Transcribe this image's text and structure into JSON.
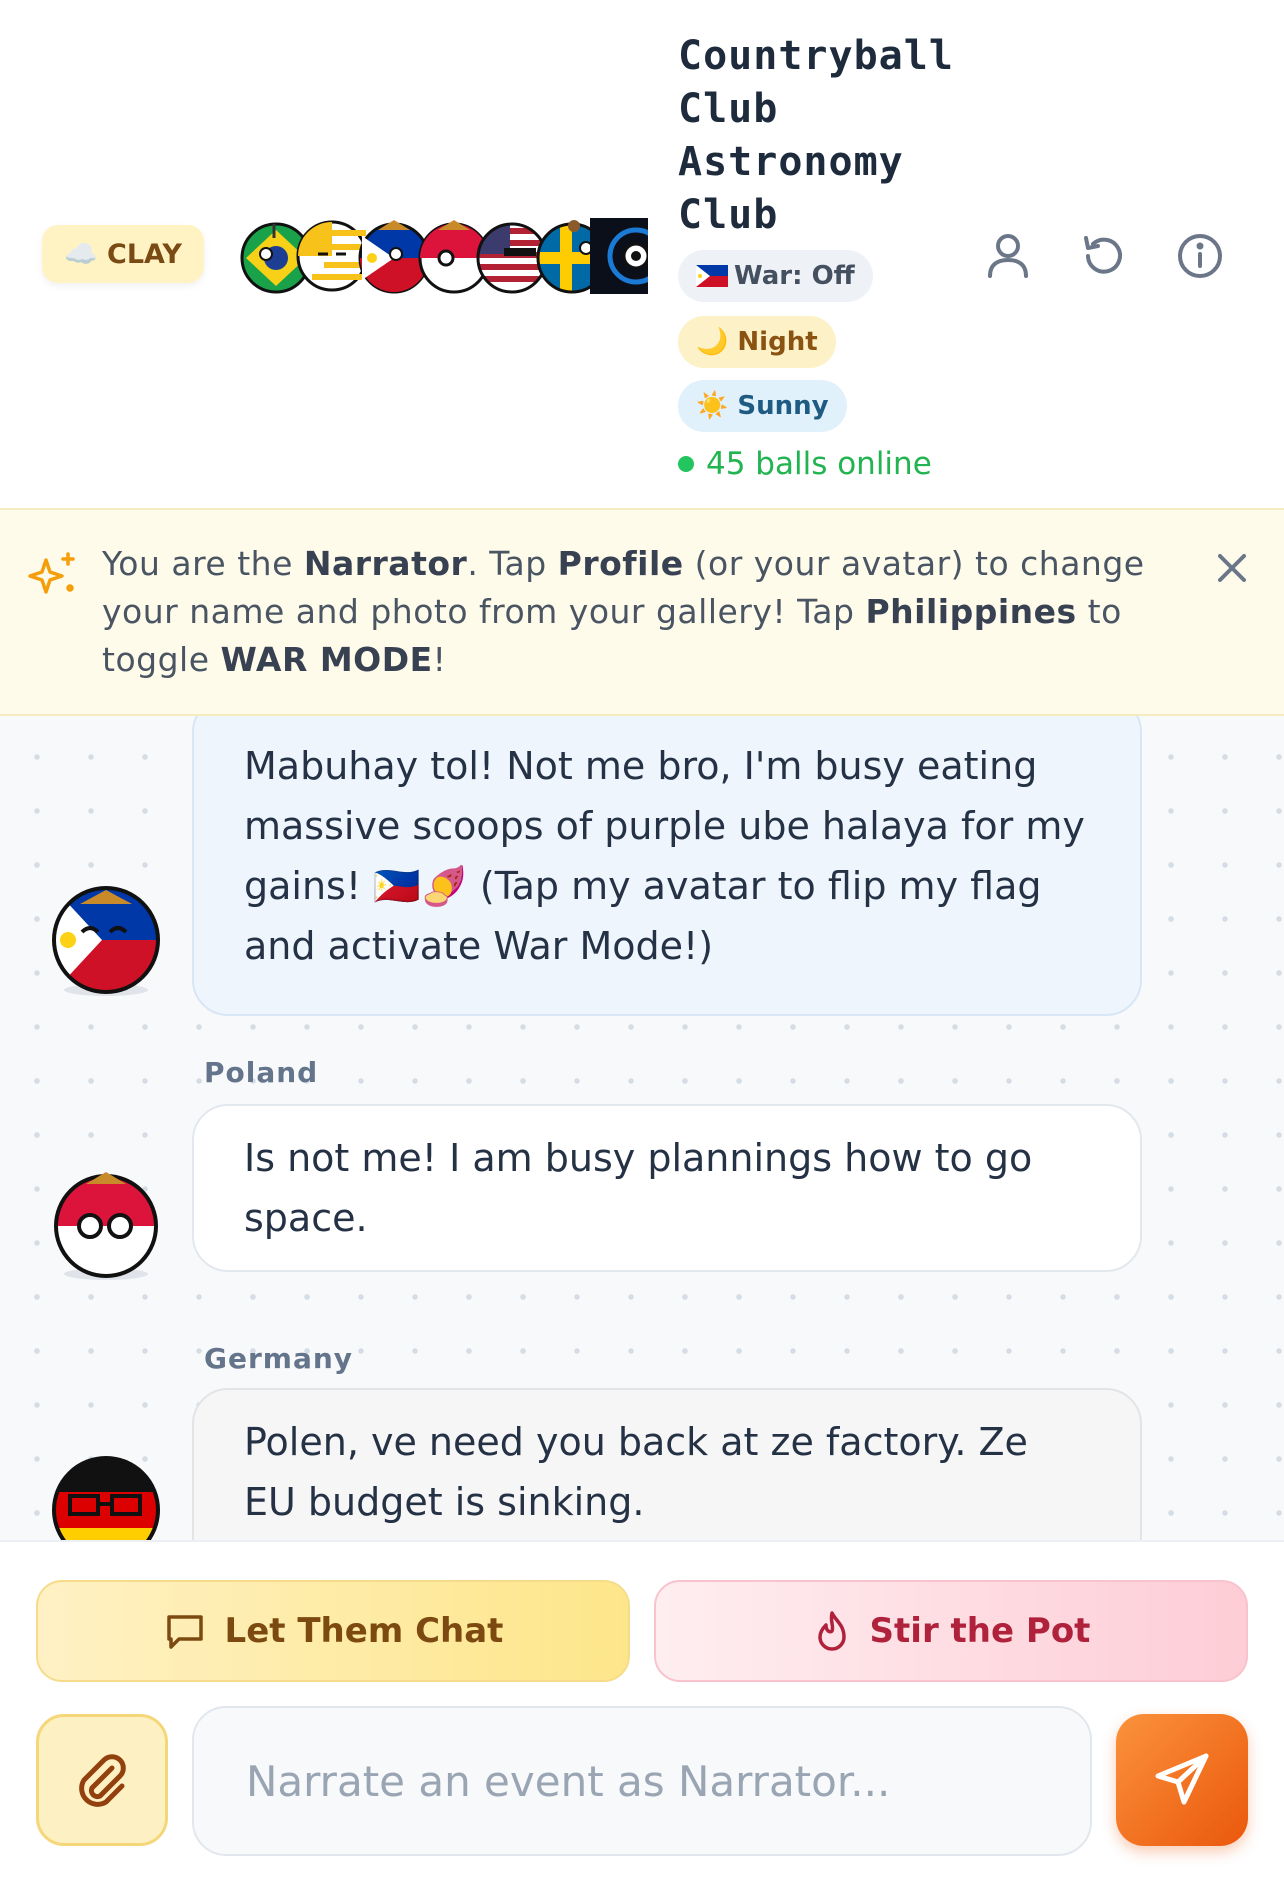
{
  "header": {
    "style_badge": "☁️ CLAY",
    "title": "Countryball Club Astronomy Club",
    "war_chip": "War: Off",
    "time_chip": "🌙 Night",
    "weather_chip": "☀️ Sunny",
    "online_text": "45 balls online",
    "icons": [
      "profile-icon",
      "reset-icon",
      "info-icon"
    ],
    "avatar_balls": [
      "Brazil",
      "Uruguay",
      "Philippines",
      "Poland",
      "USA",
      "Sweden",
      "Estonia"
    ]
  },
  "banner": {
    "prefix": "You are the ",
    "role": "Narrator",
    "mid1": ". Tap ",
    "profile": "Profile",
    "mid2": " (or your avatar) to change your name and photo from your gallery! Tap ",
    "country": "Philippines",
    "mid3": " to toggle ",
    "war_mode": "WAR MODE",
    "suffix": "!"
  },
  "messages": [
    {
      "sender": "Philippines",
      "text": "Mabuhay tol! Not me bro, I'm busy eating massive scoops of purple ube halaya for my gains! 🇵🇭🍠 (Tap my avatar to flip my flag and activate War Mode!)"
    },
    {
      "sender": "Poland",
      "text": "Is not me! I am busy plannings how to go space."
    },
    {
      "sender": "Germany",
      "text": "Polen, ve need you back at ze factory. Ze EU budget is sinking."
    }
  ],
  "footer": {
    "let_chat_label": "Let Them Chat",
    "stir_label": "Stir the Pot",
    "input_placeholder": "Narrate an event as Narrator..."
  },
  "colors": {
    "online": "#22c55e",
    "send_button": "#f97316",
    "banner_bg": "#fefbea"
  }
}
